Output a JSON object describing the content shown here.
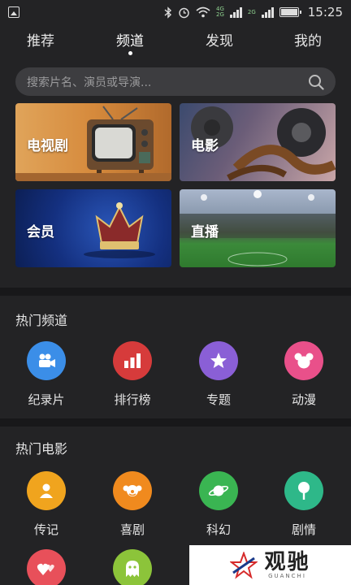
{
  "status_bar": {
    "network_top": "4G",
    "network_bottom": "2G",
    "network2_top": "2G",
    "time": "15:25"
  },
  "tabs": [
    {
      "label": "推荐"
    },
    {
      "label": "频道"
    },
    {
      "label": "发现"
    },
    {
      "label": "我的"
    }
  ],
  "active_tab": "频道",
  "search": {
    "placeholder": "搜索片名、演员或导演..."
  },
  "banners": [
    {
      "label": "电视剧"
    },
    {
      "label": "电影"
    },
    {
      "label": "会员"
    },
    {
      "label": "直播"
    }
  ],
  "hot_channels": {
    "title": "热门频道",
    "items": [
      {
        "label": "纪录片",
        "color": "#3b8ee8",
        "icon": "camera-icon"
      },
      {
        "label": "排行榜",
        "color": "#d63b3b",
        "icon": "bar-chart-icon"
      },
      {
        "label": "专题",
        "color": "#8a5fd6",
        "icon": "star-icon"
      },
      {
        "label": "动漫",
        "color": "#e9508a",
        "icon": "mouse-head-icon"
      }
    ]
  },
  "hot_movies": {
    "title": "热门电影",
    "items": [
      {
        "label": "传记",
        "color": "#f0a41e",
        "icon": "person-icon"
      },
      {
        "label": "喜剧",
        "color": "#f08a1e",
        "icon": "clown-icon"
      },
      {
        "label": "科幻",
        "color": "#3ab552",
        "icon": "planet-icon"
      },
      {
        "label": "剧情",
        "color": "#2eb889",
        "icon": "ice-cream-icon"
      },
      {
        "label": "",
        "color": "#e8505a",
        "icon": "hearts-icon"
      },
      {
        "label": "",
        "color": "#8cc43a",
        "icon": "ghost-icon"
      }
    ]
  },
  "watermark": {
    "title": "观驰",
    "subtitle": "GUANCHI"
  }
}
